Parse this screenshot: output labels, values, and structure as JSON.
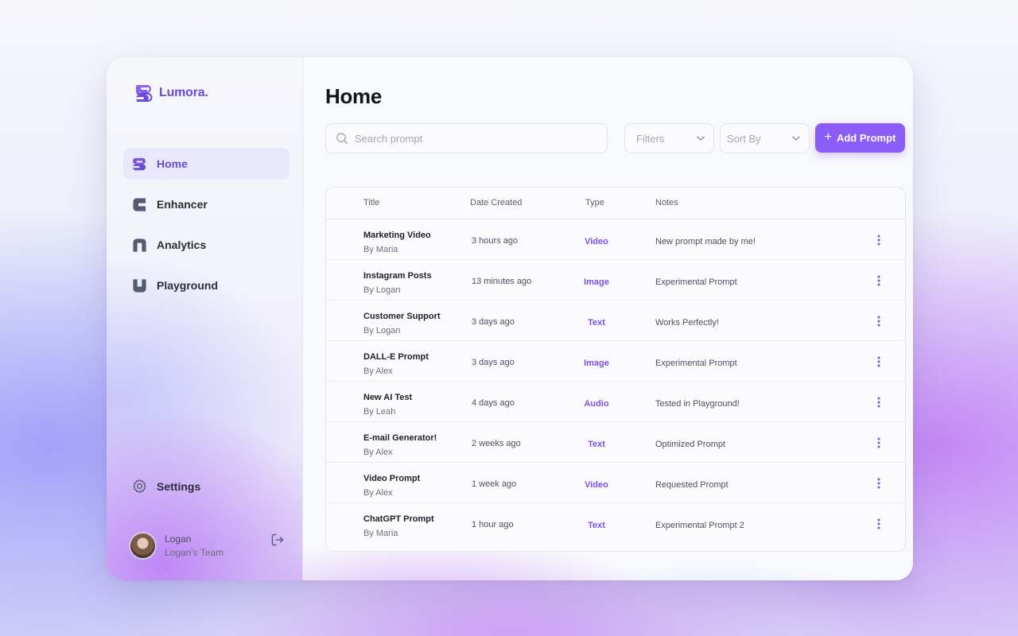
{
  "app": {
    "name": "Lumora.",
    "brand_color": "#8b5cf6",
    "accent_text": "#7b4fe8"
  },
  "sidebar": {
    "items": [
      {
        "label": "Home",
        "icon": "home-icon",
        "active": true
      },
      {
        "label": "Enhancer",
        "icon": "enhancer-icon",
        "active": false
      },
      {
        "label": "Analytics",
        "icon": "analytics-icon",
        "active": false
      },
      {
        "label": "Playground",
        "icon": "playground-icon",
        "active": false
      }
    ],
    "settings_label": "Settings",
    "user": {
      "name": "Logan",
      "team": "Logan's Team"
    }
  },
  "main": {
    "title": "Home",
    "search": {
      "placeholder": "Search prompt",
      "value": ""
    },
    "filters_label": "Filters",
    "sort_label": "Sort By",
    "add_label": "Add Prompt"
  },
  "table": {
    "columns": [
      "Title",
      "Date Created",
      "Type",
      "Notes"
    ],
    "rows": [
      {
        "title": "Marketing Video",
        "by": "By Maria",
        "date": "3 hours ago",
        "type": "Video",
        "notes": "New prompt made by me!"
      },
      {
        "title": "Instagram Posts",
        "by": "By Logan",
        "date": "13 minutes ago",
        "type": "Image",
        "notes": "Experimental Prompt"
      },
      {
        "title": "Customer Support",
        "by": "By Logan",
        "date": "3 days ago",
        "type": "Text",
        "notes": "Works Perfectly!"
      },
      {
        "title": "DALL-E Prompt",
        "by": "By Alex",
        "date": "3 days ago",
        "type": "Image",
        "notes": "Experimental Prompt"
      },
      {
        "title": "New AI Test",
        "by": "By Leah",
        "date": "4 days ago",
        "type": "Audio",
        "notes": "Tested in Playground!"
      },
      {
        "title": "E-mail Generator!",
        "by": "By Alex",
        "date": "2 weeks ago",
        "type": "Text",
        "notes": "Optimized Prompt"
      },
      {
        "title": "Video Prompt",
        "by": "By Alex",
        "date": "1 week ago",
        "type": "Video",
        "notes": "Requested Prompt"
      },
      {
        "title": "ChatGPT Prompt",
        "by": "By Maria",
        "date": "1 hour ago",
        "type": "Text",
        "notes": "Experimental Prompt 2"
      }
    ]
  }
}
